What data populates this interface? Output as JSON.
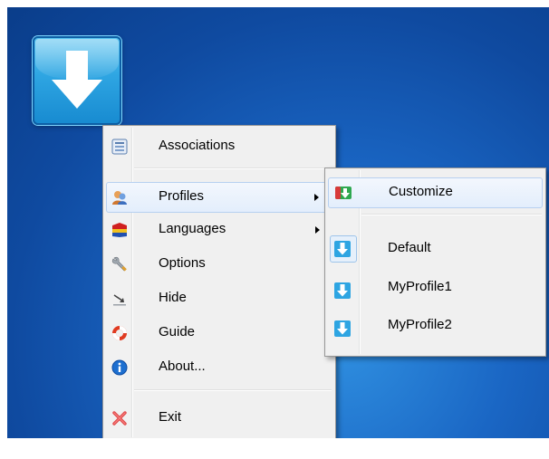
{
  "desktop": {
    "background_color": "#1a66c4",
    "app_icon": {
      "icon": "download-arrow-icon",
      "color": "#2ea5e2"
    }
  },
  "context_menu": {
    "items": [
      {
        "label": "Associations",
        "icon": "associations-icon"
      },
      {
        "label": "Profiles",
        "icon": "profiles-icon",
        "has_submenu": true,
        "highlighted": true
      },
      {
        "label": "Languages",
        "icon": "languages-icon",
        "has_submenu": true
      },
      {
        "label": "Options",
        "icon": "wrench-icon"
      },
      {
        "label": "Hide",
        "icon": "hide-arrow-icon"
      },
      {
        "label": "Guide",
        "icon": "lifebuoy-icon"
      },
      {
        "label": "About...",
        "icon": "info-icon"
      },
      {
        "label": "Exit",
        "icon": "close-x-icon"
      }
    ]
  },
  "profiles_submenu": {
    "items": [
      {
        "label": "Customize",
        "icon": "customize-icon",
        "highlighted": true
      },
      {
        "label": "Default",
        "icon": "profile-arrow-icon",
        "checked": true
      },
      {
        "label": "MyProfile1",
        "icon": "profile-arrow-icon"
      },
      {
        "label": "MyProfile2",
        "icon": "profile-arrow-icon"
      }
    ]
  },
  "colors": {
    "menu_background": "#f0f0f0",
    "highlight_border": "#b7d0f0",
    "accent_blue": "#2ea5e2"
  }
}
